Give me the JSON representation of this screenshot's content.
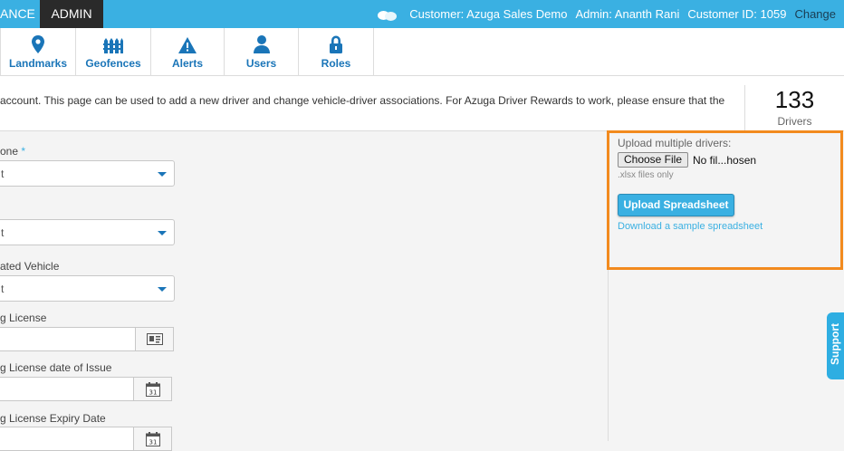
{
  "topbar": {
    "tab_maintenance": "ANCE",
    "tab_admin": "ADMIN",
    "customer": "Customer: Azuga Sales Demo",
    "admin": "Admin: Ananth Rani",
    "customer_id": "Customer ID: 1059",
    "change": "Change",
    "chat_icon": "chat-bubbles-icon"
  },
  "nav": {
    "items": [
      {
        "label": "Landmarks",
        "icon": "map-pin-icon"
      },
      {
        "label": "Geofences",
        "icon": "fence-icon"
      },
      {
        "label": "Alerts",
        "icon": "warning-icon"
      },
      {
        "label": "Users",
        "icon": "user-icon"
      },
      {
        "label": "Roles",
        "icon": "lock-icon"
      }
    ]
  },
  "info": {
    "message": "account. This page can be used to add a new driver and change vehicle-driver associations. For Azuga Driver Rewards to work, please ensure that the",
    "count": "133",
    "count_label": "Drivers"
  },
  "form": {
    "timezone_label": "one",
    "required_mark": "*",
    "timezone_value": "t",
    "field2_value": "t",
    "vehicle_label": "ated Vehicle",
    "vehicle_value": "t",
    "license_label": "g License",
    "license_issue_label": "g License date of Issue",
    "license_expiry_label": "g License Expiry Date"
  },
  "upload": {
    "title": "Upload multiple drivers:",
    "choose_button": "Choose File",
    "file_name": "No fil...hosen",
    "note": ".xlsx files only",
    "upload_button": "Upload Spreadsheet",
    "sample_link": "Download a sample spreadsheet"
  },
  "support": {
    "label": "Support"
  },
  "colors": {
    "accent": "#3ab0e2",
    "highlight_border": "#f28a1e",
    "nav_text": "#1a75b8"
  }
}
